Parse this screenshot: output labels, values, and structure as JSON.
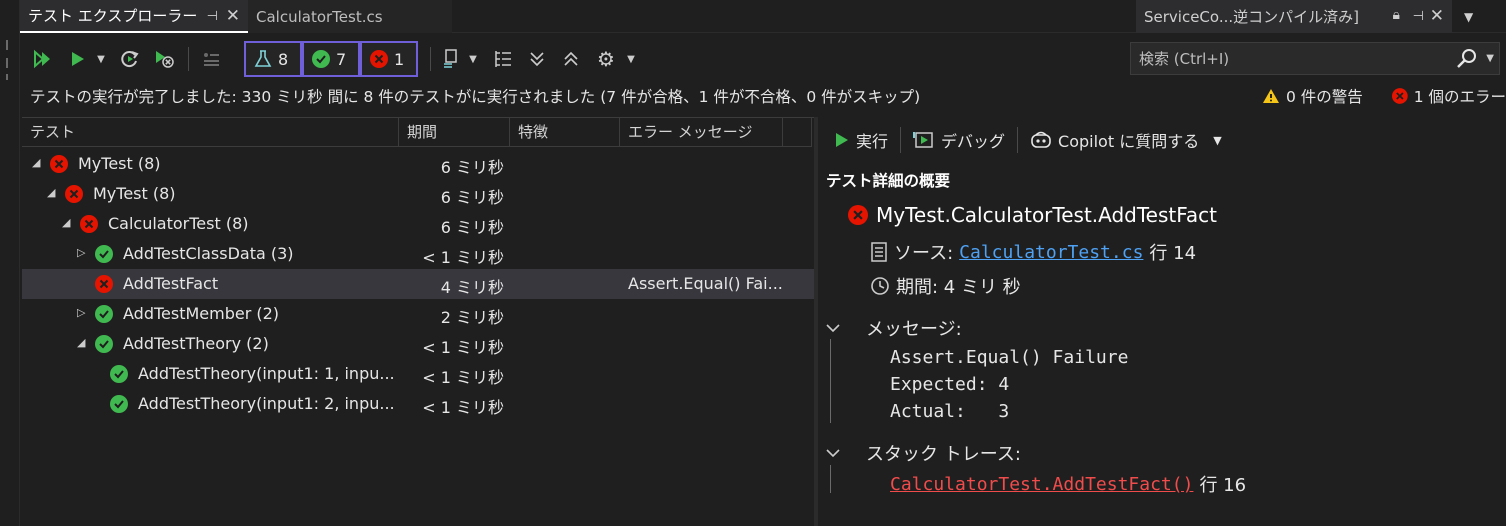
{
  "tabs": {
    "active": "テスト エクスプローラー",
    "file": "CalculatorTest.cs",
    "other": "ServiceCo...逆コンパイル済み]"
  },
  "filters": {
    "total": "8",
    "passed": "7",
    "failed": "1"
  },
  "search": {
    "placeholder": "検索 (Ctrl+I)"
  },
  "status": {
    "summary": "テストの実行が完了しました: 330 ミリ秒 間に 8 件のテストがに実行されました (7 件が合格、1 件が不合格、0 件がスキップ)",
    "warnings": "0 件の警告",
    "errors": "1 個のエラー"
  },
  "columns": [
    "テスト",
    "期間",
    "特徴",
    "エラー メッセージ"
  ],
  "rows": [
    {
      "name": "MyTest  (8)",
      "duration": "6 ミリ秒",
      "message": "",
      "status": "failed",
      "expander": "expanded"
    },
    {
      "name": "MyTest  (8)",
      "duration": "6 ミリ秒",
      "message": "",
      "status": "failed",
      "expander": "expanded"
    },
    {
      "name": "CalculatorTest  (8)",
      "duration": "6 ミリ秒",
      "message": "",
      "status": "failed",
      "expander": "expanded"
    },
    {
      "name": "AddTestClassData  (3)",
      "duration": "< 1 ミリ秒",
      "message": "",
      "status": "passed",
      "expander": "collapsed"
    },
    {
      "name": "AddTestFact",
      "duration": "4 ミリ秒",
      "message": "Assert.Equal() Fai...",
      "status": "failed",
      "expander": "none"
    },
    {
      "name": "AddTestMember  (2)",
      "duration": "2 ミリ秒",
      "message": "",
      "status": "passed",
      "expander": "collapsed"
    },
    {
      "name": "AddTestTheory  (2)",
      "duration": "< 1 ミリ秒",
      "message": "",
      "status": "passed",
      "expander": "expanded"
    },
    {
      "name": "AddTestTheory(input1: 1, inpu...",
      "duration": "< 1 ミリ秒",
      "message": "",
      "status": "passed",
      "expander": "none"
    },
    {
      "name": "AddTestTheory(input1: 2, inpu...",
      "duration": "< 1 ミリ秒",
      "message": "",
      "status": "passed",
      "expander": "none"
    }
  ],
  "detail": {
    "run_label": "実行",
    "debug_label": "デバッグ",
    "copilot_label": "Copilot に質問する",
    "title": "テスト詳細の概要",
    "test_name": "MyTest.CalculatorTest.AddTestFact",
    "source_label": "ソース:",
    "source_link": "CalculatorTest.cs",
    "source_line": "行 14",
    "duration_label": "期間: 4  ミリ 秒",
    "message_label": "メッセージ:",
    "message_lines": "Assert.Equal() Failure\nExpected: 4\nActual:   3",
    "stack_label": "スタック トレース:",
    "stack_link": "CalculatorTest.AddTestFact()",
    "stack_line": "行 16"
  },
  "colors": {
    "failed": "#e51400",
    "passed": "#3fb950",
    "accent": "#6f5fd8",
    "link": "#4ea1f3",
    "error_link": "#f14c4c"
  }
}
